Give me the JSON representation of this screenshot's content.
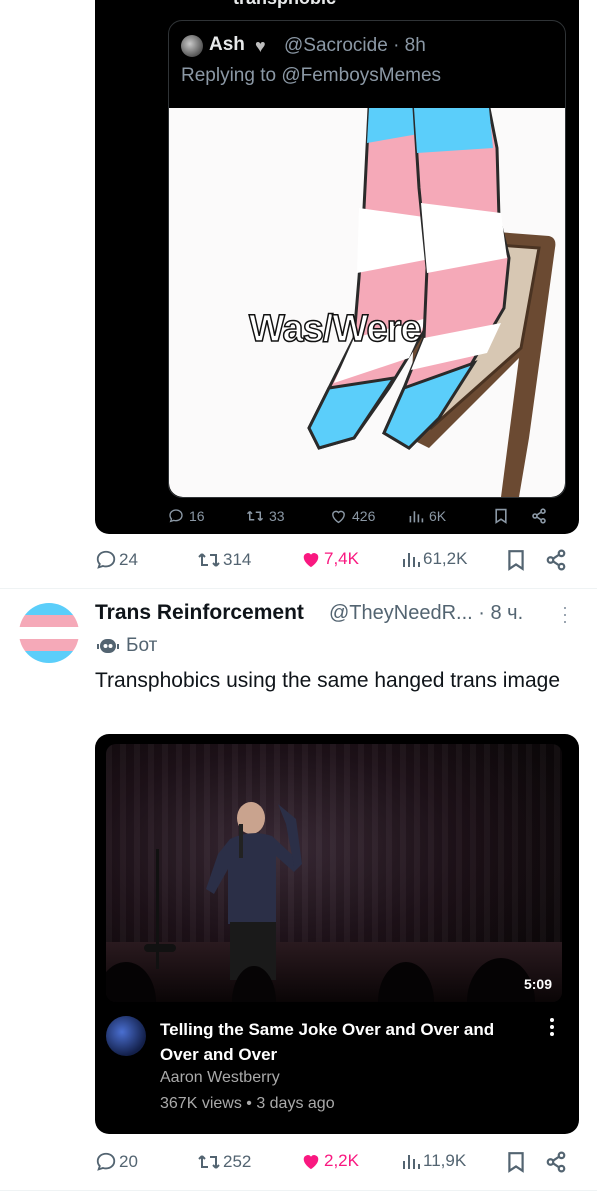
{
  "quoted": {
    "cut_text": "transphobic",
    "author_name": "Ash",
    "author_handle": "@Sacrocide",
    "time": "· 8h",
    "replying": "Replying to @FemboysMemes",
    "meme_caption": "Was/Were",
    "stats": {
      "replies": "16",
      "retweets": "33",
      "likes": "426",
      "views": "6K"
    }
  },
  "tweet1_actions": {
    "replies": "24",
    "retweets": "314",
    "likes": "7,4K",
    "views": "61,2K"
  },
  "tweet2": {
    "author_name": "Trans Reinforcement",
    "author_handle": "@TheyNeedR...",
    "time": "· 8 ч.",
    "bot_label": "Бот",
    "text": "Transphobics using the same hanged trans image",
    "video": {
      "duration": "5:09",
      "title": "Telling the Same Joke Over and Over and Over and Over",
      "channel": "Aaron Westberry",
      "meta": "367K views • 3 days ago"
    },
    "actions": {
      "replies": "20",
      "retweets": "252",
      "likes": "2,2K",
      "views": "11,9K"
    }
  },
  "colors": {
    "like_pink": "#f91880",
    "muted": "#536471",
    "flag_blue": "#5bcefa",
    "flag_pink": "#f5a9b8"
  }
}
